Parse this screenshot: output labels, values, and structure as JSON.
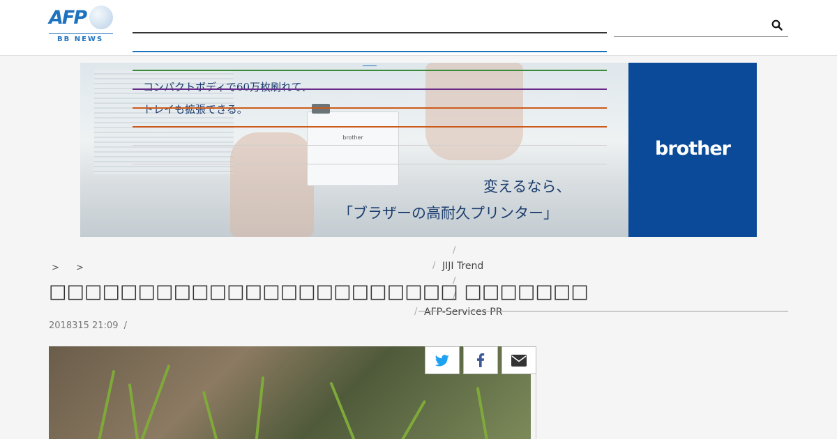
{
  "header": {
    "logo_text": "AFP",
    "logo_sub": "BB NEWS",
    "search_placeholder": ""
  },
  "ad": {
    "copy_line1": "コンパクトボディで60万枚刷れて、",
    "copy_line2": "トレイも拡張できる。",
    "printer_label": "brother",
    "headline1": "変えるなら、",
    "headline2": "「ブラザーの高耐久プリンター」",
    "brand": "brother",
    "brand_color": "#0b4a98"
  },
  "menu": {
    "items": [
      "JIJI Trend",
      "AFP-Services PR"
    ]
  },
  "breadcrumb": {
    "sep1": ">",
    "sep2": ">"
  },
  "article": {
    "title": "□□□□□□□□□□□□□□□□□□□□□□□ □□□□□□□",
    "date": "2018315 21:09",
    "date_sep": "/"
  },
  "share": {
    "twitter": "twitter-icon",
    "facebook": "facebook-icon",
    "email": "email-icon"
  },
  "colors": {
    "accent": "#1e73be",
    "line_green": "#3a8a3a",
    "line_purple": "#6a2a8a",
    "line_orange": "#cc5a1a"
  }
}
